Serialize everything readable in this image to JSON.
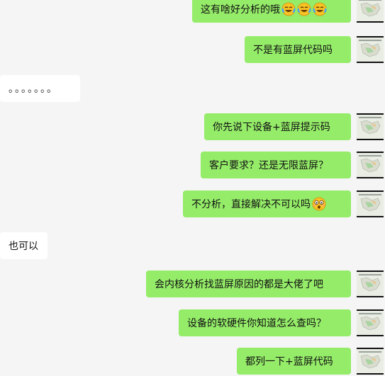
{
  "messages": [
    {
      "side": "out",
      "text": "这有啥好分析的哦",
      "emoji": [
        "laugh-cry-emoji",
        "laugh-cry-emoji",
        "laugh-cry-emoji"
      ]
    },
    {
      "side": "out",
      "text": "不是有蓝屏代码吗"
    },
    {
      "side": "in",
      "text": "。。。。。。。"
    },
    {
      "side": "out",
      "text": "你先说下设备+蓝屏提示码"
    },
    {
      "side": "out",
      "text": "客户要求？还是无限蓝屏？"
    },
    {
      "side": "out",
      "text": "不分析，直接解决不可以吗",
      "emoji": [
        "shocked-emoji"
      ]
    },
    {
      "side": "in",
      "text": "也可以"
    },
    {
      "side": "out",
      "text": "会内核分析找蓝屏原因的都是大佬了吧"
    },
    {
      "side": "out",
      "text": "设备的软硬件你知道怎么查吗？"
    },
    {
      "side": "out",
      "text": "都列一下+蓝屏代码"
    }
  ],
  "colors": {
    "outgoing_bubble": "#95ec69",
    "incoming_bubble": "#ffffff",
    "background": "#f5f5f5"
  },
  "avatar": {
    "icon": "map-thumbnail-avatar"
  }
}
